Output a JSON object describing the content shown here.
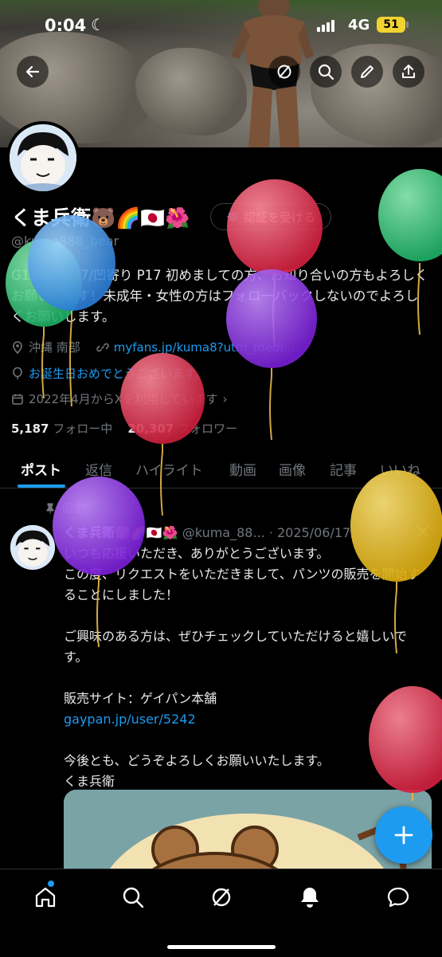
{
  "status_bar": {
    "time": "0:04",
    "network": "4G",
    "battery": "51"
  },
  "header": {
    "back_icon": "arrow-left-icon",
    "actions": [
      "grok-icon",
      "search-icon",
      "edit-icon",
      "share-icon"
    ]
  },
  "profile": {
    "name": "くま兵衛🐻🌈🇯🇵🌺",
    "verify_label": "認証を受ける",
    "handle": "@kuma888_bear",
    "bio": "G142/25/37/凹寄り P17 初めましての方、お知り合いの方もよろしくお願いします！未成年・女性の方はフォローバックしないのでよろしくお願いします。",
    "location": "沖縄 南部",
    "website": "myfans.jp/kuma8?utm_medi...",
    "birthday": "お誕生日おめでとうございます。",
    "joined": "2022年4月からXを利用しています",
    "following_count": "5,187",
    "following_label": "フォロー中",
    "followers_count": "20,307",
    "followers_label": "フォロワー"
  },
  "tabs": [
    "ポスト",
    "返信",
    "ハイライト",
    "動画",
    "画像",
    "記事",
    "いいね"
  ],
  "pinned_post": {
    "pinned_label": "固定",
    "author": "くま兵衛🐻🌈🇯🇵🌺",
    "handle": "@kuma_88...",
    "date": "· 2025/06/17",
    "lines": [
      "いつも応援いただき、ありがとうございます。",
      "この度、リクエストをいただきまして、パンツの販売を開始することにしました！",
      "",
      "ご興味のある方は、ぜひチェックしていただけると嬉しいです。",
      "",
      "販売サイト：ゲイパン本舗",
      "gaypan.jp/user/5242",
      "",
      "今後とも、どうぞよろしくお願いいたします。",
      "くま兵衛"
    ]
  },
  "fab_icon": "plus-icon",
  "bottom_nav": [
    "home-icon",
    "search-icon",
    "grok-icon",
    "notifications-icon",
    "messages-icon"
  ],
  "colors": {
    "accent": "#1d9bf0",
    "background": "#000000",
    "muted": "#71767b"
  }
}
